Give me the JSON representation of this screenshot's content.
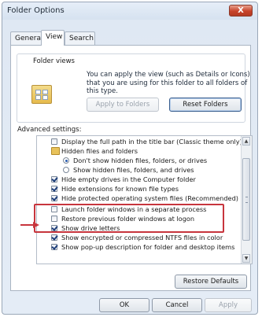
{
  "window": {
    "title": "Folder Options",
    "close_label": "X"
  },
  "tabs": [
    {
      "label": "General",
      "active": false
    },
    {
      "label": "View",
      "active": true
    },
    {
      "label": "Search",
      "active": false
    }
  ],
  "folder_views": {
    "title": "Folder views",
    "description": "You can apply the view (such as Details or Icons) that you are using for this folder to all folders of this type.",
    "apply_label": "Apply to Folders",
    "reset_label": "Reset Folders"
  },
  "advanced": {
    "label": "Advanced settings:",
    "items": [
      {
        "type": "checkbox",
        "checked": false,
        "label": "Display the full path in the title bar (Classic theme only)"
      },
      {
        "type": "folder",
        "label": "Hidden files and folders"
      },
      {
        "type": "radio",
        "checked": true,
        "label": "Don't show hidden files, folders, or drives"
      },
      {
        "type": "radio",
        "checked": false,
        "label": "Show hidden files, folders, and drives"
      },
      {
        "type": "checkbox",
        "checked": true,
        "label": "Hide empty drives in the Computer folder"
      },
      {
        "type": "checkbox",
        "checked": true,
        "label": "Hide extensions for known file types"
      },
      {
        "type": "checkbox",
        "checked": true,
        "label": "Hide protected operating system files (Recommended)"
      },
      {
        "type": "checkbox",
        "checked": false,
        "label": "Launch folder windows in a separate process"
      },
      {
        "type": "checkbox",
        "checked": false,
        "label": "Restore previous folder windows at logon"
      },
      {
        "type": "checkbox",
        "checked": true,
        "label": "Show drive letters"
      },
      {
        "type": "checkbox",
        "checked": true,
        "label": "Show encrypted or compressed NTFS files in color"
      },
      {
        "type": "checkbox",
        "checked": true,
        "label": "Show pop-up description for folder and desktop items"
      }
    ],
    "restore_defaults_label": "Restore Defaults"
  },
  "footer": {
    "ok_label": "OK",
    "cancel_label": "Cancel",
    "apply_label": "Apply"
  },
  "colors": {
    "highlight": "#c7353d",
    "accent": "#2a5db0"
  }
}
